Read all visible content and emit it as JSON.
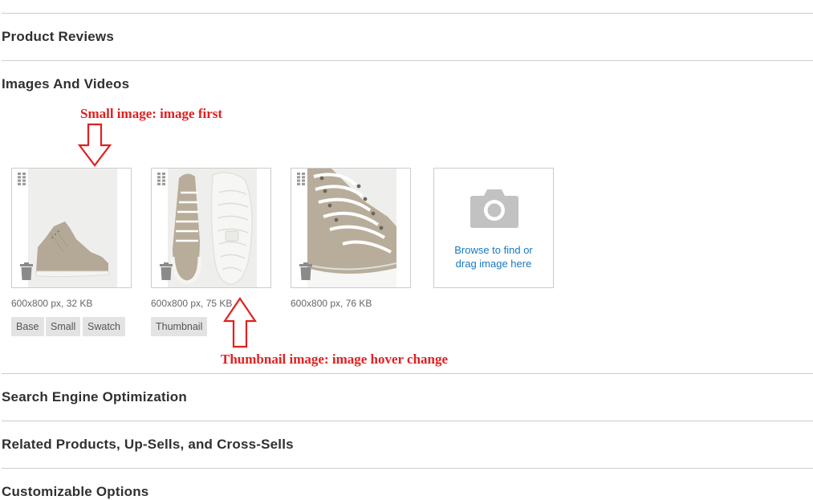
{
  "sections": {
    "product_reviews": "Product Reviews",
    "images_videos": "Images And Videos",
    "seo": "Search Engine Optimization",
    "related": "Related Products, Up-Sells, and Cross-Sells",
    "customizable": "Customizable Options"
  },
  "annotations": {
    "small_image": "Small image: image first",
    "thumbnail_image": "Thumbnail image: image hover change"
  },
  "images": [
    {
      "meta": "600x800 px, 32 KB",
      "roles": [
        "Base",
        "Small",
        "Swatch"
      ]
    },
    {
      "meta": "600x800 px, 75 KB",
      "roles": [
        "Thumbnail"
      ]
    },
    {
      "meta": "600x800 px, 76 KB",
      "roles": []
    }
  ],
  "uploader": {
    "line1": "Browse to find or",
    "line2": "drag image here",
    "icon": "camera-icon"
  },
  "colors": {
    "annotation": "#e02020",
    "link": "#1979c3",
    "role_badge": "#e3e3e3",
    "border": "#cccccc"
  }
}
